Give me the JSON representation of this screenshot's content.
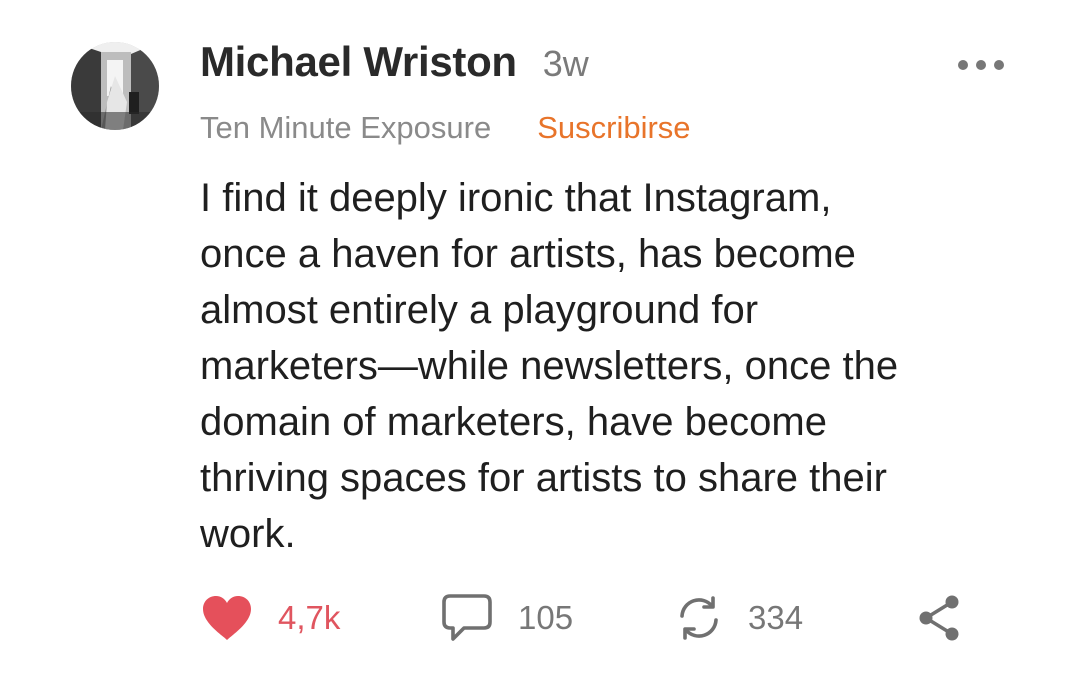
{
  "post": {
    "author": "Michael Wriston",
    "timestamp": "3w",
    "publication": "Ten Minute Exposure",
    "subscribe_label": "Suscribirse",
    "text": "I find it deeply ironic that Instagram,\nonce a haven for artists, has become\nalmost entirely a playground for\nmarketers—while newsletters, once the\ndomain of marketers, have become\nthriving spaces for artists to share their\nwork."
  },
  "actions": {
    "likes": "4,7k",
    "comments": "105",
    "restacks": "334"
  },
  "icons": {
    "avatar": "avatar-photo",
    "more": "more-dots-icon",
    "like": "heart-icon",
    "comment": "comment-bubble-icon",
    "restack": "restack-arrows-icon",
    "share": "share-icon"
  },
  "colors": {
    "accent": "#e8742a",
    "like": "#e0555f",
    "text": "#1f1f1f",
    "muted": "#8a8a8a"
  }
}
